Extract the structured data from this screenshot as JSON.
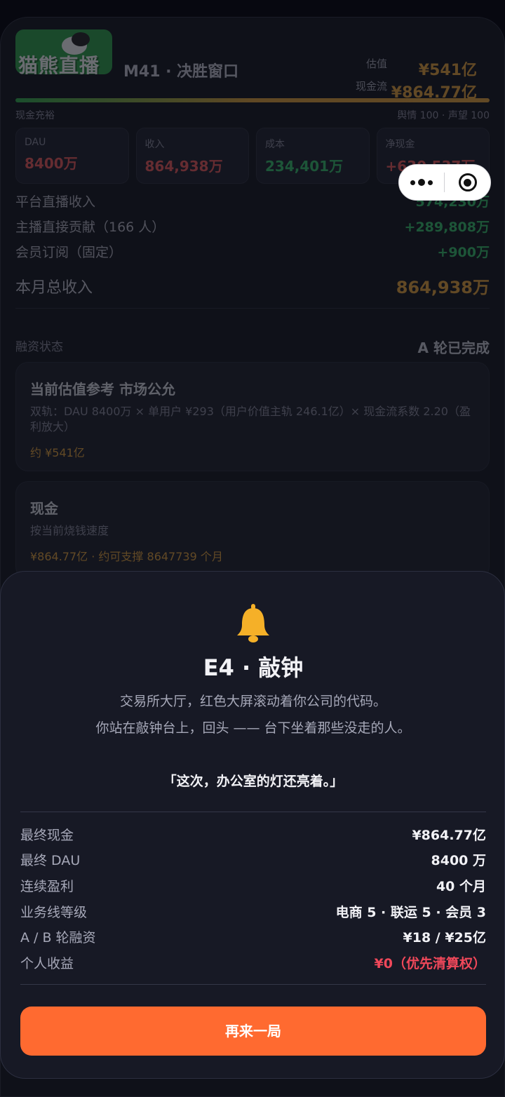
{
  "game": {
    "logo_text": "猫熊直播",
    "stage": "M41 · 决胜窗口",
    "valuation_label": "估值",
    "valuation_value": "¥541亿",
    "cash_label": "现金流",
    "cash_value": "¥864.77亿",
    "status_left": "现金充裕",
    "status_right": "舆情 100 · 声望 100",
    "metrics": [
      {
        "label": "DAU",
        "value": "8400万"
      },
      {
        "label": "收入",
        "value": "864,938万"
      },
      {
        "label": "成本",
        "value": "234,401万"
      },
      {
        "label": "净现金",
        "value": "+630,537万"
      }
    ],
    "revenue_rows": [
      {
        "label": "平台直播收入",
        "value": "574,230万"
      },
      {
        "label": "主播直接贡献（166 人）",
        "value": "+289,808万"
      },
      {
        "label": "会员订阅（固定）",
        "value": "+900万"
      }
    ],
    "revenue_total_label": "本月总收入",
    "revenue_total_value": "864,938万",
    "financing_label": "融资状态",
    "financing_status": "A 轮已完成",
    "valuation_card": {
      "title": "当前估值参考 市场公允",
      "desc": "双轨：DAU 8400万 × 单用户 ¥293（用户价值主轨 246.1亿）× 现金流系数 2.20（盈利放大）",
      "foot": "约 ¥541亿"
    },
    "cash_card": {
      "title": "现金",
      "desc": "按当前烧钱速度",
      "foot": "¥864.77亿 · 约可支撑 8647739 个月"
    }
  },
  "capsule": {
    "more_icon": "more-dots-icon",
    "close_icon": "close-target-icon"
  },
  "ending": {
    "icon": "bell-icon",
    "title": "E4 · 敲钟",
    "line1": "交易所大厅，红色大屏滚动着你公司的代码。",
    "line2": "你站在敲钟台上，回头 —— 台下坐着那些没走的人。",
    "quote": "「这次，办公室的灯还亮着。」",
    "stats": [
      {
        "label": "最终现金",
        "value": "¥864.77亿"
      },
      {
        "label": "最终 DAU",
        "value": "8400 万"
      },
      {
        "label": "连续盈利",
        "value": "40 个月"
      },
      {
        "label": "业务线等级",
        "value": "电商 5 · 联运 5 · 会员 3"
      },
      {
        "label": "A / B 轮融资",
        "value": "¥18 / ¥25亿"
      },
      {
        "label": "个人收益",
        "value": "¥0（优先清算权）"
      }
    ],
    "replay_label": "再来一局"
  },
  "colors": {
    "accent": "#ff6a30",
    "valuation": "#e8a53a",
    "positive": "#35c46a",
    "negative": "#f05a5a",
    "warning": "#f0485a",
    "bell": "#f5b028"
  }
}
